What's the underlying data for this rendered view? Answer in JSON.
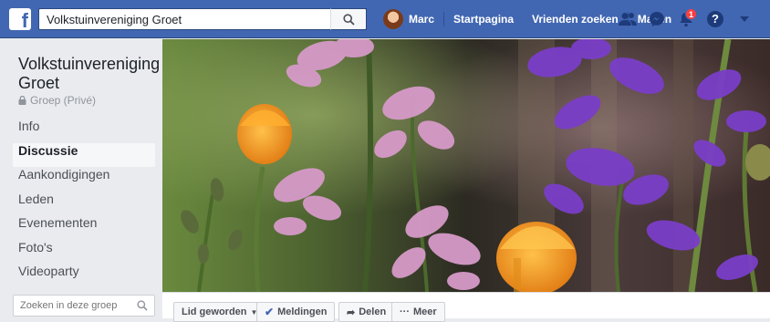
{
  "topbar": {
    "logo_letter": "f",
    "search_value": "Volkstuinvereniging Groet",
    "profile_name": "Marc",
    "nav": [
      "Startpagina",
      "Vrienden zoeken",
      "Maken"
    ],
    "notification_count": "1",
    "help_label": "?"
  },
  "group": {
    "title": "Volkstuinvereniging Groet",
    "privacy": "Groep (Privé)",
    "menu": [
      "Info",
      "Discussie",
      "Aankondigingen",
      "Leden",
      "Evenementen",
      "Foto's",
      "Videoparty"
    ],
    "active_menu": "Discussie",
    "search_placeholder": "Zoeken in deze groep"
  },
  "actions": {
    "joined": "Lid geworden",
    "notifications": "Meldingen",
    "share": "Delen",
    "more": "Meer"
  },
  "colors": {
    "brand": "#4267b2",
    "badge": "#fa3e3e"
  }
}
